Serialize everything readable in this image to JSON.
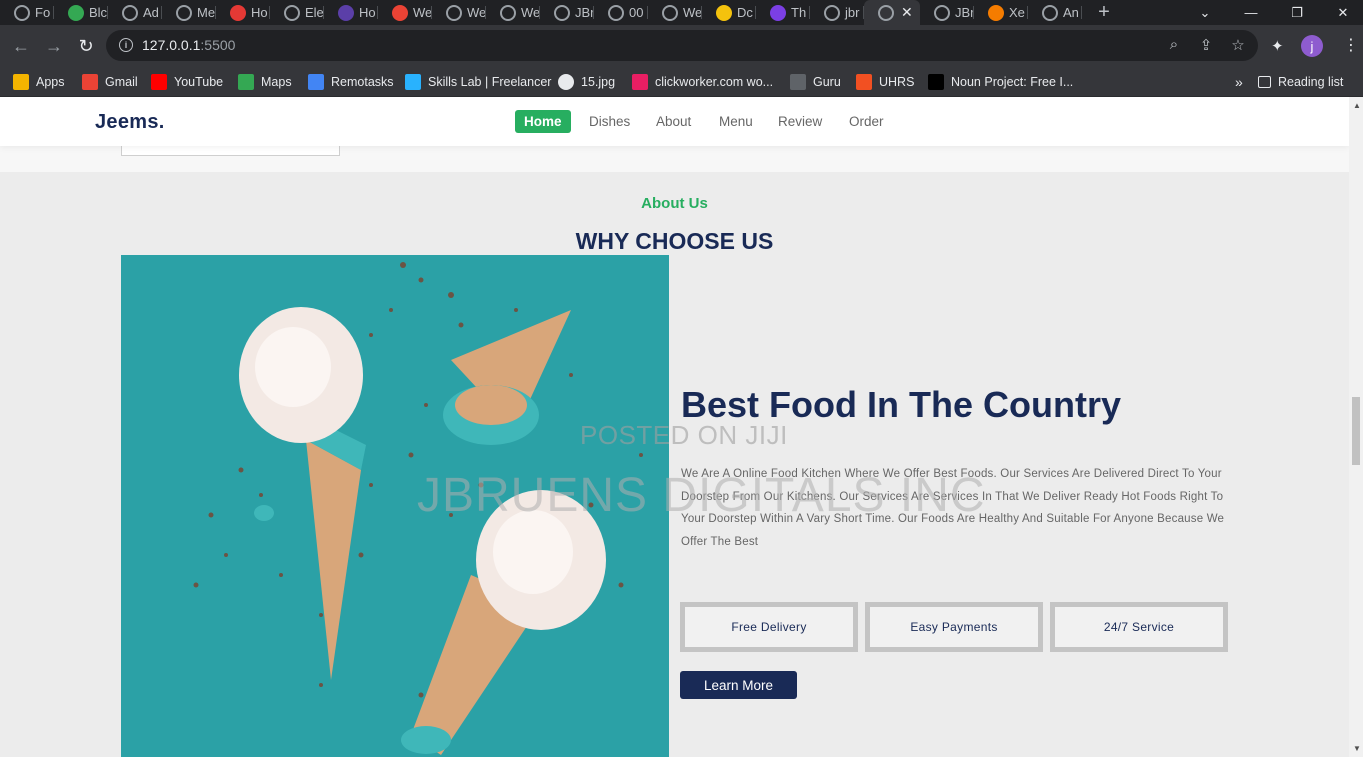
{
  "browser": {
    "tabs": [
      {
        "label": "Fo",
        "icon": "globe-icon"
      },
      {
        "label": "Blc",
        "icon": "green-square-icon"
      },
      {
        "label": "Ad",
        "icon": "globe-icon"
      },
      {
        "label": "Me",
        "icon": "globe-icon"
      },
      {
        "label": "Ho",
        "icon": "red-x-icon"
      },
      {
        "label": "Ele",
        "icon": "globe-icon"
      },
      {
        "label": "Ho",
        "icon": "purple-circle-icon"
      },
      {
        "label": "We",
        "icon": "gmail-icon"
      },
      {
        "label": "We",
        "icon": "globe-icon"
      },
      {
        "label": "We",
        "icon": "globe-icon"
      },
      {
        "label": "JBr",
        "icon": "globe-icon"
      },
      {
        "label": "00",
        "icon": "globe-icon"
      },
      {
        "label": "We",
        "icon": "globe-icon"
      },
      {
        "label": "Dc",
        "icon": "yellow-icon"
      },
      {
        "label": "Th",
        "icon": "purple-h-icon"
      },
      {
        "label": "jbr",
        "icon": "globe-icon"
      },
      {
        "label": "",
        "icon": "globe-icon",
        "active": true
      },
      {
        "label": "JBr",
        "icon": "globe-icon"
      },
      {
        "label": "Xe",
        "icon": "x-logo-icon"
      },
      {
        "label": "An",
        "icon": "globe-icon"
      }
    ],
    "active_tab_close": "✕",
    "new_tab": "+",
    "url_host": "127.0.0.1",
    "url_port": ":5500",
    "profile_initial": "j",
    "bookmarks": [
      {
        "label": "Apps",
        "icon": "apps-grid-icon"
      },
      {
        "label": "Gmail",
        "icon": "gmail-icon"
      },
      {
        "label": "YouTube",
        "icon": "youtube-icon"
      },
      {
        "label": "Maps",
        "icon": "maps-icon"
      },
      {
        "label": "Remotasks",
        "icon": "remotasks-icon"
      },
      {
        "label": "Skills Lab | Freelancer",
        "icon": "freelancer-icon"
      },
      {
        "label": "15.jpg",
        "icon": "globe-icon"
      },
      {
        "label": "clickworker.com wo...",
        "icon": "clickworker-icon"
      },
      {
        "label": "Guru",
        "icon": "guru-icon"
      },
      {
        "label": "UHRS",
        "icon": "microsoft-icon"
      },
      {
        "label": "Noun Project: Free I...",
        "icon": "noun-project-icon"
      }
    ],
    "bookmarks_overflow": "»",
    "reading_list": "Reading list"
  },
  "site": {
    "logo": "Jeems.",
    "nav": [
      {
        "label": "Home",
        "active": true
      },
      {
        "label": "Dishes"
      },
      {
        "label": "About"
      },
      {
        "label": "Menu"
      },
      {
        "label": "Review"
      },
      {
        "label": "Order"
      }
    ]
  },
  "about": {
    "sub_heading": "About Us",
    "heading": "WHY CHOOSE US",
    "title": "Best Food In The Country",
    "paragraph": "We Are A Online Food Kitchen Where We Offer Best Foods. Our Services Are Delivered Direct To Your Doorstep From Our Kitchens. Our Services Are Services In That We Deliver Ready Hot Foods Right To Your Doorstep Within A Vary Short Time. Our Foods Are Healthy And Suitable For Anyone Because We Offer The Best",
    "features": [
      "Free Delivery",
      "Easy Payments",
      "24/7 Service"
    ],
    "cta": "Learn More"
  },
  "watermark": {
    "line1": "POSTED ON JIJI",
    "line2": "JBRUENS DIGITALS INC"
  },
  "colors": {
    "brand_green": "#27ae60",
    "brand_navy": "#192a56",
    "image_teal": "#2ba1a6"
  }
}
